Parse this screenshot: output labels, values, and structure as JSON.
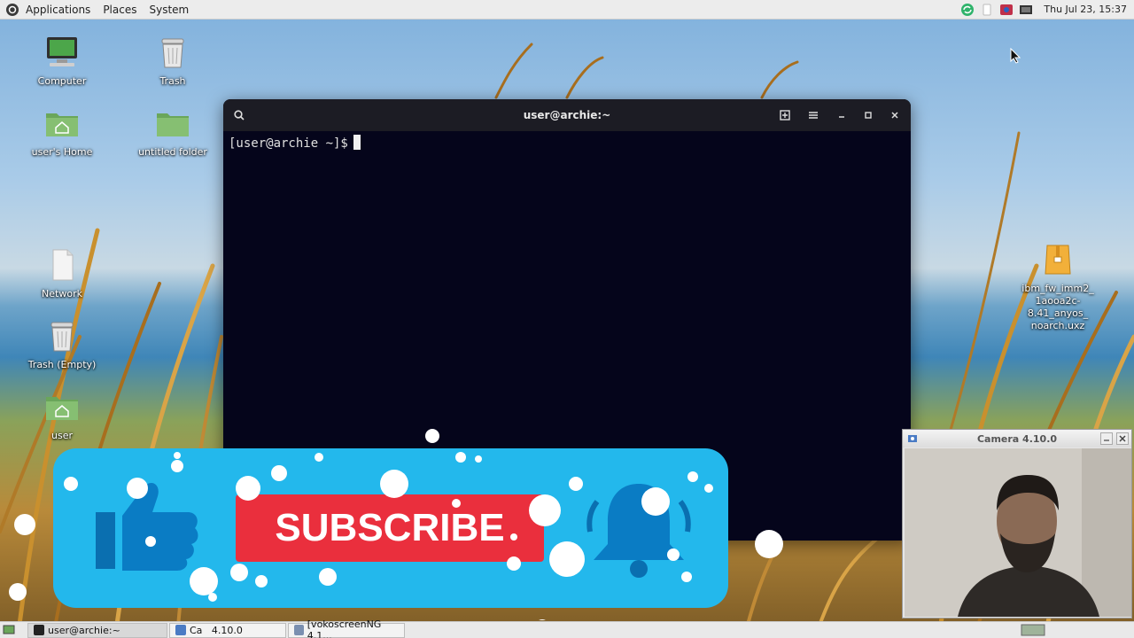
{
  "top_panel": {
    "menus": [
      "Applications",
      "Places",
      "System"
    ],
    "clock": "Thu Jul 23, 15:37"
  },
  "desktop": {
    "icons": [
      {
        "label": "Computer"
      },
      {
        "label": "Trash"
      },
      {
        "label": "user's Home"
      },
      {
        "label": "untitled folder"
      },
      {
        "label": "Network"
      },
      {
        "label": "Trash (Empty)"
      },
      {
        "label": "user"
      },
      {
        "label": "ibm_fw_imm2_\n1aooa2c-8.41_anyos_\nnoarch.uxz"
      }
    ]
  },
  "terminal": {
    "title": "user@archie:~",
    "prompt": "[user@archie ~]$"
  },
  "camera": {
    "title": "Camera 4.10.0"
  },
  "banner": {
    "subscribe_label": "SUBSCRIBE"
  },
  "taskbar": {
    "items": [
      {
        "label": "user@archie:~"
      },
      {
        "label": "Ca   4.10.0"
      },
      {
        "label": "[vokoscreenNG 4.1..."
      }
    ]
  },
  "colors": {
    "banner_blue": "#23b8ec",
    "subscribe_red": "#ea2f3d",
    "terminal_bg": "#05051b"
  }
}
